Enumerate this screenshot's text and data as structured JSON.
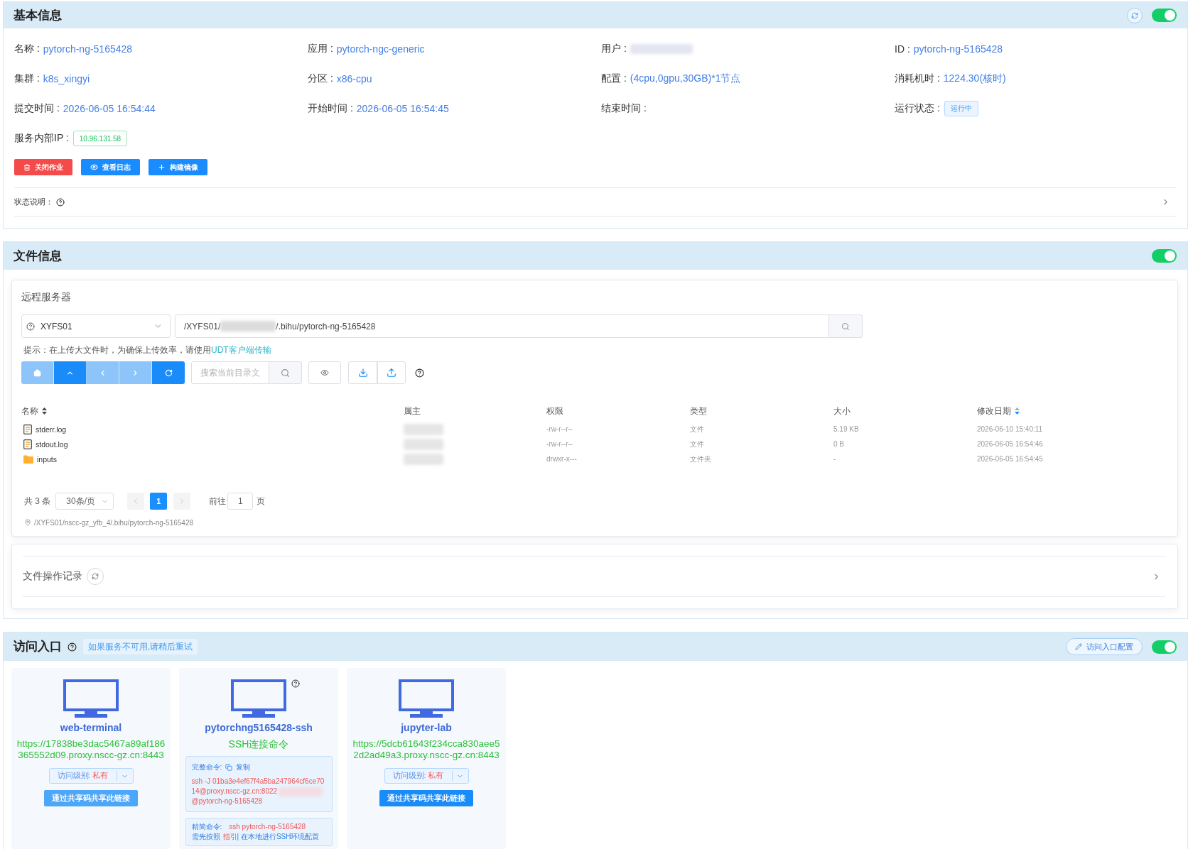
{
  "basic_info": {
    "title": "基本信息",
    "on": true,
    "fields": [
      {
        "kind": "value",
        "label": "名称 :",
        "value": "pytorch-ng-5165428"
      },
      {
        "kind": "value",
        "label": "应用 :",
        "value": "pytorch-ngc-generic"
      },
      {
        "kind": "redacted",
        "label": "用户 :"
      },
      {
        "kind": "value",
        "label": "ID :",
        "value": "pytorch-ng-5165428"
      },
      {
        "kind": "value",
        "label": "集群 :",
        "value": "k8s_xingyi"
      },
      {
        "kind": "value",
        "label": "分区 :",
        "value": "x86-cpu"
      },
      {
        "kind": "value",
        "label": "配置 :",
        "value": "(4cpu,0gpu,30GB)*1节点"
      },
      {
        "kind": "value",
        "label": "消耗机时 :",
        "value": "1224.30(核时)"
      },
      {
        "kind": "value",
        "label": "提交时间 :",
        "value": "2026-06-05 16:54:44"
      },
      {
        "kind": "value",
        "label": "开始时间 :",
        "value": "2026-06-05 16:54:45"
      },
      {
        "kind": "blank",
        "label": "结束时间 :"
      },
      {
        "kind": "status",
        "label": "运行状态 :",
        "value": "运行中"
      },
      {
        "kind": "ip",
        "label": "服务内部IP :",
        "value": "10.96.131.58"
      }
    ],
    "actions": [
      {
        "kind": "danger",
        "label": "关闭作业"
      },
      {
        "kind": "primary",
        "label": "查看日志"
      },
      {
        "kind": "primary",
        "label": "构建镜像"
      }
    ],
    "status_note": {
      "label": "状态说明：",
      "expanded": false
    }
  },
  "file_info": {
    "title": "文件信息",
    "on": true,
    "remote": {
      "title": "远程服务器",
      "server": "XYFS01",
      "path_before_redaction": "/XYFS01/",
      "path_after_redaction": "/.bihu/pytorch-ng-5165428",
      "hint": "提示：在上传大文件时，为确保上传效率，请使用",
      "hint_link": "UDT客户端传输",
      "nav_buttons": [
        {
          "disabled": true
        },
        {
          "disabled": false
        },
        {
          "disabled": true
        },
        {
          "disabled": true
        },
        {
          "disabled": false
        }
      ],
      "search_placeholder": "搜索当前目录文",
      "table": {
        "columns": [
          {
            "label": "名称",
            "sortable": true,
            "sort_active": false
          },
          {
            "label": "属主",
            "sortable": false
          },
          {
            "label": "权限",
            "sortable": false
          },
          {
            "label": "类型",
            "sortable": false
          },
          {
            "label": "大小",
            "sortable": false
          },
          {
            "label": "修改日期",
            "sortable": true,
            "sort_active": true
          }
        ],
        "rows": [
          {
            "kind": "file",
            "name": "stderr.log",
            "permissions": "-rw-r--r--",
            "type": "文件",
            "size": "5.19 KB",
            "modified": "2026-06-10 15:40:11"
          },
          {
            "kind": "file",
            "name": "stdout.log",
            "permissions": "-rw-r--r--",
            "type": "文件",
            "size": "0 B",
            "modified": "2026-06-05 16:54:46"
          },
          {
            "kind": "folder",
            "name": "inputs",
            "permissions": "drwxr-x---",
            "type": "文件夹",
            "size": "-",
            "modified": "2026-06-05 16:54:45"
          }
        ]
      },
      "pagination": {
        "total": "共 3 条",
        "page_size": "30条/页",
        "prev": {
          "disabled": true
        },
        "pages": [
          {
            "label": "1",
            "selected": true
          }
        ],
        "next": {
          "disabled": true
        },
        "goto_label": "前往",
        "goto_value": "1",
        "goto_suffix": "页"
      },
      "location": "/XYFS01/nscc-gz_yfb_4/.bihu/pytorch-ng-5165428"
    },
    "operation_log": {
      "title": "文件操作记录",
      "expanded": false
    }
  },
  "access": {
    "title": "访问入口",
    "note": "如果服务不可用,请稍后重试",
    "config_button": "访问入口配置",
    "on": true,
    "entries": [
      {
        "kind": "web",
        "name": "web-terminal",
        "url": "https://17838be3dac5467a89af186365552d09.proxy.nscc-gz.cn:8443",
        "access_label": "访问级别:",
        "access_value": "私有",
        "share_button": {
          "label": "通过共享码共享此链接",
          "disabled": true
        }
      },
      {
        "kind": "ssh",
        "name": "pytorchng5165428-ssh",
        "subtitle": "SSH连接命令",
        "full_command": {
          "label": "完整命令:",
          "copy": "复制",
          "line_1": "ssh -J 01ba3e4ef67f4a5ba247964cf6ce70",
          "line_2_before_redaction": "14@proxy.nscc-gz.cn:8022",
          "after_redaction": "@pytorch-ng-5165428"
        },
        "short_command": {
          "label": "精简命令:",
          "command": "ssh pytorch-ng-5165428",
          "note_before": "需先按照",
          "link": "指引",
          "note_after": "| 在本地进行SSH环境配置"
        }
      },
      {
        "kind": "web",
        "name": "jupyter-lab",
        "url": "https://5dcb61643f234cca830aee52d2ad49a3.proxy.nscc-gz.cn:8443",
        "access_label": "访问级别:",
        "access_value": "私有",
        "share_button": {
          "label": "通过共享码共享此链接",
          "disabled": false
        }
      }
    ]
  }
}
